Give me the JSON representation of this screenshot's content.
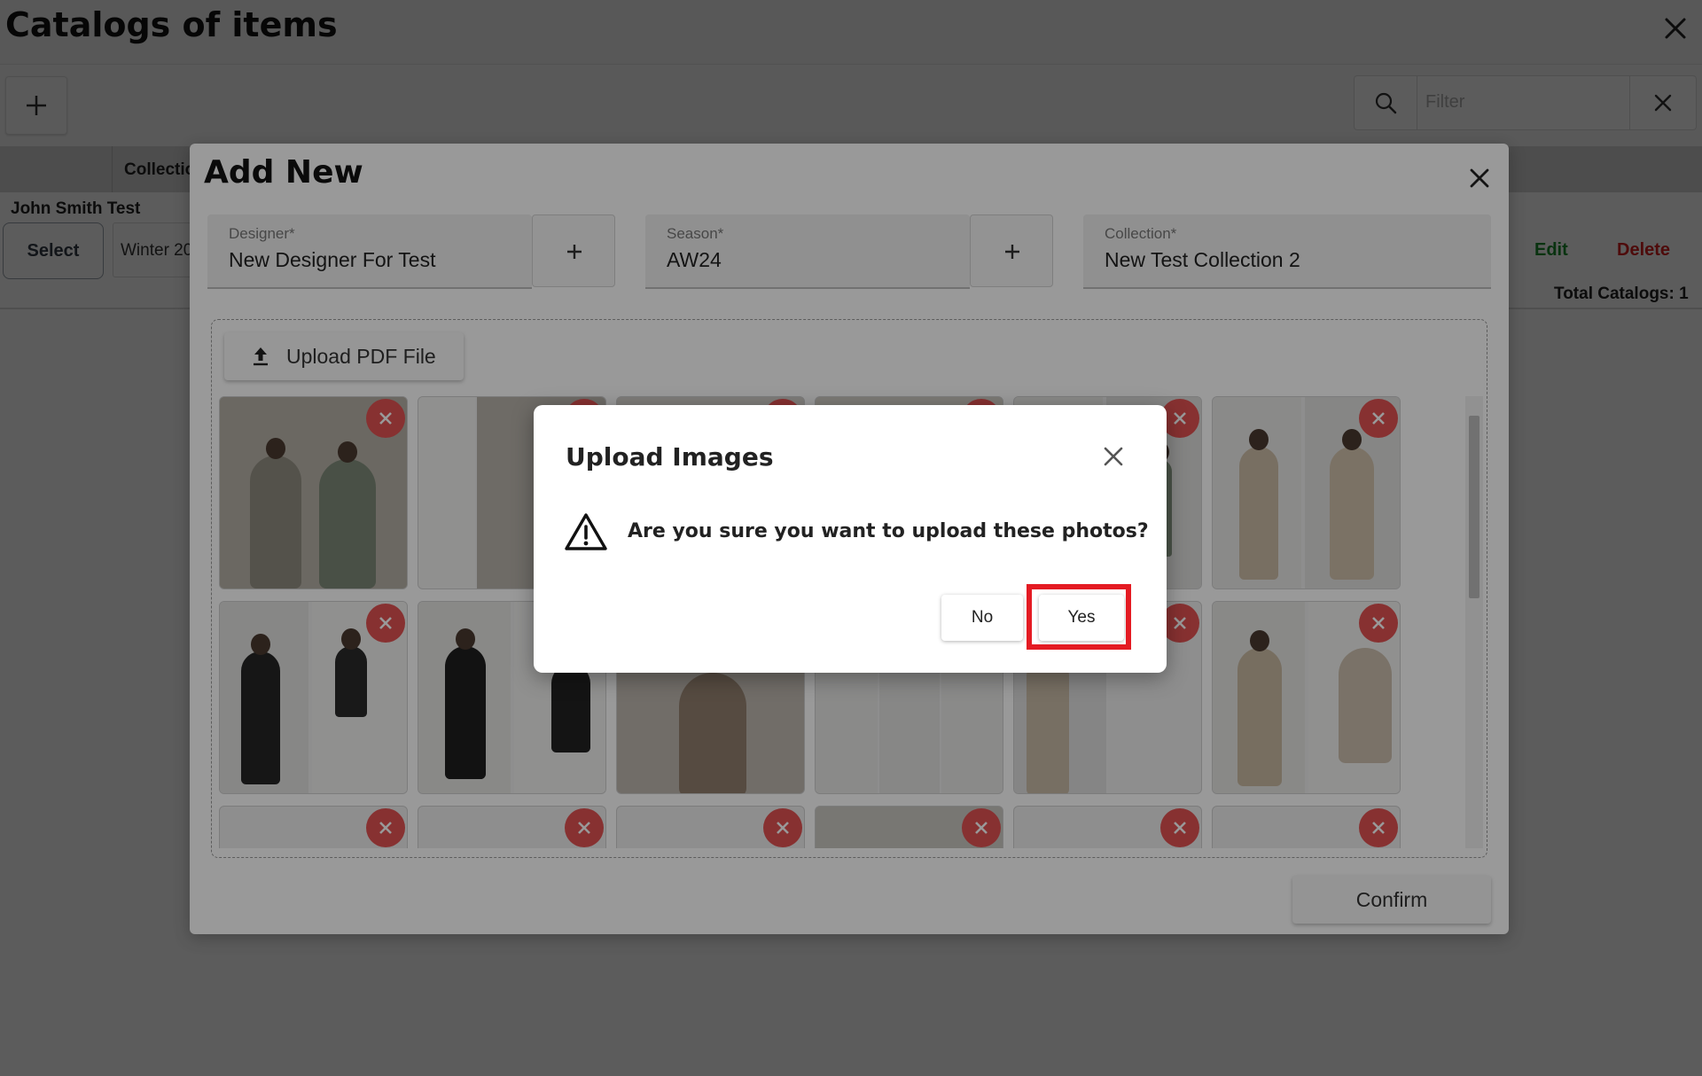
{
  "page": {
    "title": "Catalogs of items",
    "filter_placeholder": "Filter"
  },
  "table": {
    "column_label": "Collectio",
    "row": {
      "name": "John Smith Test",
      "select_label": "Select",
      "season_cell": "Winter 20",
      "edit_label": "Edit",
      "delete_label": "Delete"
    },
    "total": "Total Catalogs: 1"
  },
  "add_dialog": {
    "title": "Add New",
    "fields": [
      {
        "label": "Designer*",
        "value": "New Designer For Test"
      },
      {
        "label": "Season*",
        "value": "AW24"
      },
      {
        "label": "Collection*",
        "value": "New Test Collection 2"
      }
    ],
    "upload_label": "Upload PDF File",
    "confirm_label": "Confirm"
  },
  "confirm_modal": {
    "title": "Upload Images",
    "message": "Are you sure you want to upload these photos?",
    "no_label": "No",
    "yes_label": "Yes"
  },
  "icons": [
    "plus-icon",
    "search-icon",
    "close-icon",
    "upload-icon",
    "warning-icon",
    "remove-icon"
  ],
  "colors": {
    "edit": "#1a8f2f",
    "delete": "#d92020",
    "remove_badge": "#e15353",
    "highlight": "#e41b23"
  }
}
